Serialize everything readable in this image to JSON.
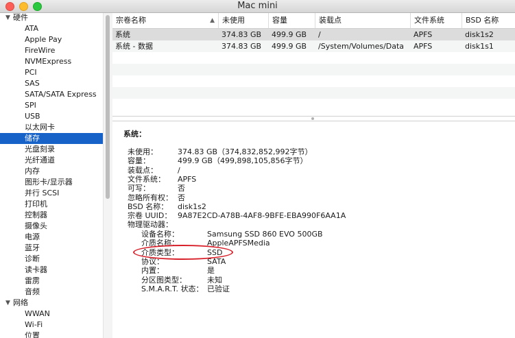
{
  "window": {
    "title": "Mac mini"
  },
  "sidebar": {
    "items": [
      {
        "label": "硬件",
        "type": "category"
      },
      {
        "label": "ATA"
      },
      {
        "label": "Apple Pay"
      },
      {
        "label": "FireWire"
      },
      {
        "label": "NVMExpress"
      },
      {
        "label": "PCI"
      },
      {
        "label": "SAS"
      },
      {
        "label": "SATA/SATA Express"
      },
      {
        "label": "SPI"
      },
      {
        "label": "USB"
      },
      {
        "label": "以太网卡"
      },
      {
        "label": "储存",
        "selected": true
      },
      {
        "label": "光盘刻录"
      },
      {
        "label": "光纤通道"
      },
      {
        "label": "内存"
      },
      {
        "label": "图形卡/显示器"
      },
      {
        "label": "并行 SCSI"
      },
      {
        "label": "打印机"
      },
      {
        "label": "控制器"
      },
      {
        "label": "摄像头"
      },
      {
        "label": "电源"
      },
      {
        "label": "蓝牙"
      },
      {
        "label": "诊断"
      },
      {
        "label": "读卡器"
      },
      {
        "label": "雷雳"
      },
      {
        "label": "音频"
      },
      {
        "label": "网络",
        "type": "category"
      },
      {
        "label": "WWAN"
      },
      {
        "label": "Wi-Fi"
      },
      {
        "label": "位置"
      }
    ]
  },
  "table": {
    "headers": [
      "宗卷名称",
      "未使用",
      "容量",
      "装载点",
      "文件系统",
      "BSD 名称"
    ],
    "rows": [
      [
        "系统",
        "374.83 GB",
        "499.9 GB",
        "/",
        "APFS",
        "disk1s2"
      ],
      [
        "系统 - 数据",
        "374.83 GB",
        "499.9 GB",
        "/System/Volumes/Data",
        "APFS",
        "disk1s1"
      ]
    ]
  },
  "detail": {
    "title": "系统：",
    "fields": [
      {
        "key": "未使用：",
        "value": "374.83 GB（374,832,852,992字节）"
      },
      {
        "key": "容量：",
        "value": "499.9 GB（499,898,105,856字节）"
      },
      {
        "key": "装载点：",
        "value": "/"
      },
      {
        "key": "文件系统：",
        "value": "APFS"
      },
      {
        "key": "可写：",
        "value": "否"
      },
      {
        "key": "忽略所有权：",
        "value": "否"
      },
      {
        "key": "BSD 名称：",
        "value": "disk1s2"
      },
      {
        "key": "宗卷 UUID：",
        "value": "9A87E2CD-A78B-4AF8-9BFE-EBA990F6AA1A"
      },
      {
        "key": "物理驱动器：",
        "value": ""
      }
    ],
    "physical": [
      {
        "key": "设备名称：",
        "value": "Samsung SSD 860 EVO 500GB"
      },
      {
        "key": "介质名称：",
        "value": "AppleAPFSMedia"
      },
      {
        "key": "介质类型：",
        "value": "SSD"
      },
      {
        "key": "协议：",
        "value": "SATA"
      },
      {
        "key": "内置：",
        "value": "是"
      },
      {
        "key": "分区图类型：",
        "value": "未知"
      },
      {
        "key": "S.M.A.R.T. 状态：",
        "value": "已验证"
      }
    ]
  },
  "annotation": {
    "color": "#d8202a"
  }
}
